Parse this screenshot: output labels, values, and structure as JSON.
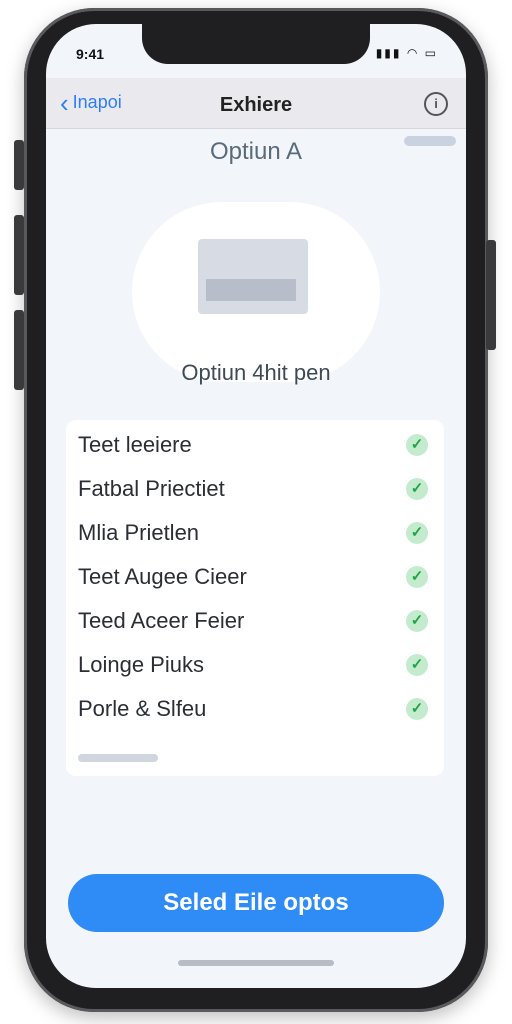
{
  "status": {
    "time": "9:41",
    "icons": "▮▮▮ ◠ ▭"
  },
  "navbar": {
    "back_label": "Inapoi",
    "title": "Exhiere",
    "info_icon": "info-icon"
  },
  "option": {
    "label": "Optiun A",
    "price_small": "",
    "price": "Optiun 4hit pen"
  },
  "features": [
    {
      "label": "Teet leeiere",
      "checked": true
    },
    {
      "label": "Fatbal Priectiet",
      "checked": true
    },
    {
      "label": "Mlia Prietlen",
      "checked": true
    },
    {
      "label": "Teet Augee Cieer",
      "checked": true
    },
    {
      "label": "Teed Aceer Feier",
      "checked": true
    },
    {
      "label": "Loinge Piuks",
      "checked": true
    },
    {
      "label": "Porle & Slfeu",
      "checked": true
    }
  ],
  "select_button": {
    "label": "Seled Eile optos"
  },
  "colors": {
    "accent": "#2f8cf7",
    "check": "#21a645",
    "check_bg": "#c5ebce"
  }
}
